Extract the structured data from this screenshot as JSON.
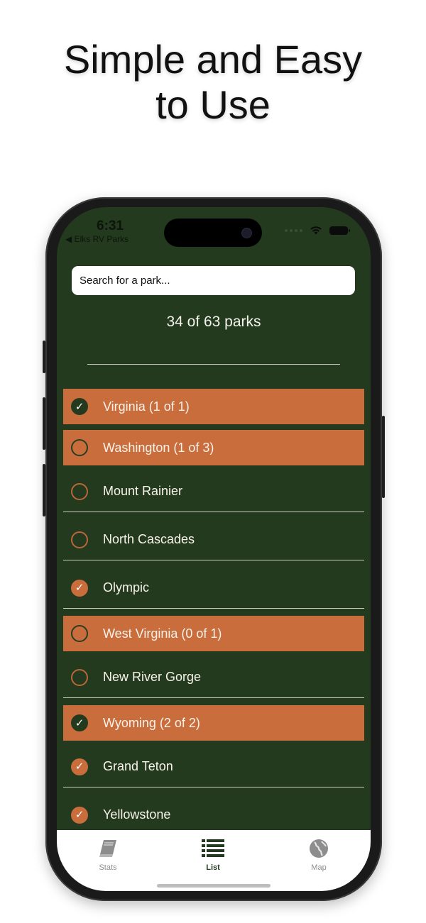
{
  "headline": {
    "line1": "Simple and Easy",
    "line2": "to Use"
  },
  "status_bar": {
    "time": "6:31",
    "back_app": "◀ Elks RV Parks"
  },
  "search": {
    "placeholder": "Search for a park...",
    "value": ""
  },
  "summary": {
    "count_text": "34 of 63 parks"
  },
  "list": {
    "rows": [
      {
        "type": "state",
        "label": "Virginia (1 of 1)",
        "checked": true
      },
      {
        "type": "state",
        "label": "Washington (1 of 3)",
        "checked": false
      },
      {
        "type": "park",
        "label": "Mount Rainier",
        "checked": false
      },
      {
        "type": "park",
        "label": "North Cascades",
        "checked": false
      },
      {
        "type": "park",
        "label": "Olympic",
        "checked": true
      },
      {
        "type": "state",
        "label": "West Virginia (0 of 1)",
        "checked": false
      },
      {
        "type": "park",
        "label": "New River Gorge",
        "checked": false
      },
      {
        "type": "state",
        "label": "Wyoming (2 of 2)",
        "checked": true
      },
      {
        "type": "park",
        "label": "Grand Teton",
        "checked": true
      },
      {
        "type": "park",
        "label": "Yellowstone",
        "checked": true
      }
    ]
  },
  "tabbar": {
    "stats": {
      "label": "Stats",
      "icon": "book-icon"
    },
    "list": {
      "label": "List",
      "icon": "list-icon"
    },
    "map": {
      "label": "Map",
      "icon": "globe-icon"
    }
  },
  "colors": {
    "background": "#243a1e",
    "accent": "#c96d3d",
    "tab_active": "#243a1e",
    "tab_inactive": "#8d8d8d"
  }
}
